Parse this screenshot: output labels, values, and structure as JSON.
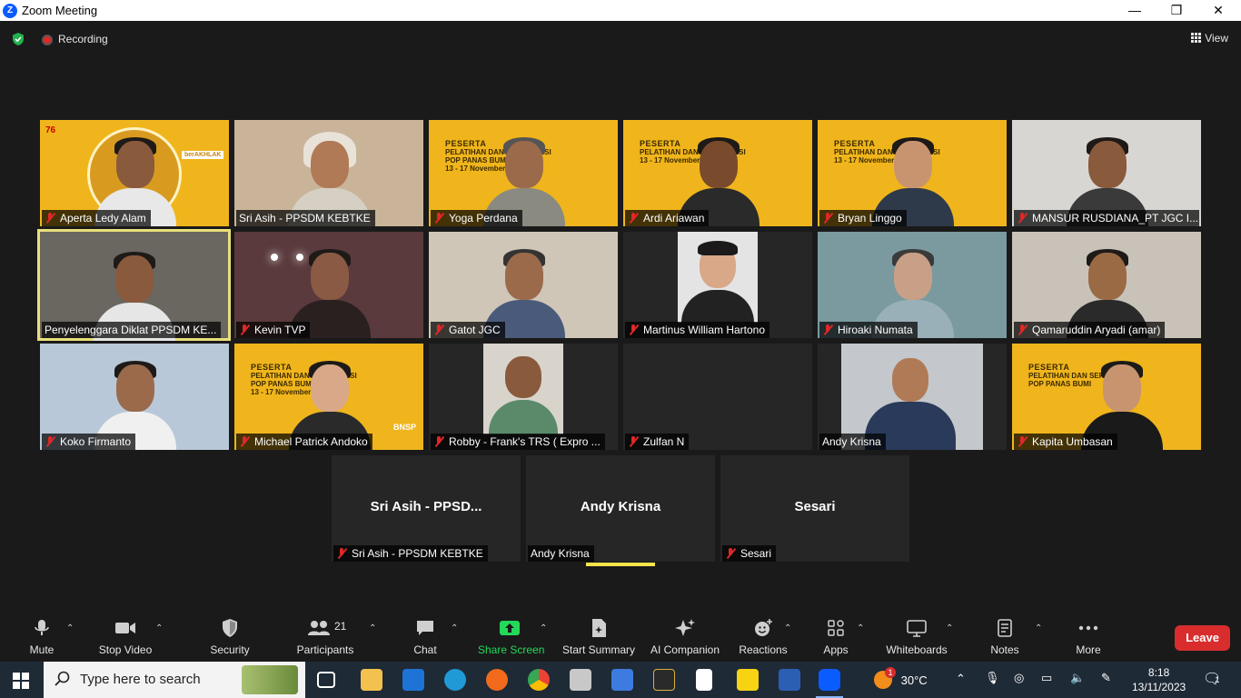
{
  "window": {
    "title": "Zoom Meeting",
    "minimize": "—",
    "maximize": "❐",
    "close": "✕"
  },
  "meeting_bar": {
    "recording_label": "Recording",
    "view_label": "View"
  },
  "participants": [
    {
      "name": "Aperta Ledy Alam",
      "muted": true
    },
    {
      "name": "Sri Asih - PPSDM KEBTKE",
      "muted": false
    },
    {
      "name": "Yoga Perdana",
      "muted": true
    },
    {
      "name": "Ardi Ariawan",
      "muted": true
    },
    {
      "name": "Bryan Linggo",
      "muted": true
    },
    {
      "name": "MANSUR RUSDIANA_PT JGC I...",
      "muted": true
    },
    {
      "name": "Penyelenggara Diklat PPSDM KE...",
      "muted": false
    },
    {
      "name": "Kevin TVP",
      "muted": true
    },
    {
      "name": "Gatot JGC",
      "muted": true
    },
    {
      "name": "Martinus William Hartono",
      "muted": true
    },
    {
      "name": "Hiroaki Numata",
      "muted": true
    },
    {
      "name": "Qamaruddin Aryadi (amar)",
      "muted": true
    },
    {
      "name": "Koko Firmanto",
      "muted": true
    },
    {
      "name": "Michael Patrick Andoko",
      "muted": true
    },
    {
      "name": "Robby - Frank's TRS ( Expro ...",
      "muted": true
    },
    {
      "name": "Zulfan N",
      "muted": true
    },
    {
      "name": "Andy Krisna",
      "muted": false
    },
    {
      "name": "Kapita Umbasan",
      "muted": true
    }
  ],
  "name_tiles": [
    {
      "display": "Sri Asih - PPSD...",
      "label": "Sri Asih - PPSDM KEBTKE",
      "muted": true
    },
    {
      "display": "Andy Krisna",
      "label": "Andy Krisna",
      "muted": false
    },
    {
      "display": "Sesari",
      "label": "Sesari",
      "muted": true
    }
  ],
  "banner": {
    "line1": "PESERTA",
    "line2": "PELATIHAN DAN SERTIFIKASI",
    "line3": "POP PANAS BUMI",
    "line4": "13 - 17 November 2023",
    "logo": "BNSP",
    "slogan": "berAKHLAK",
    "anniv": "76"
  },
  "toolbar": {
    "mute": "Mute",
    "stop_video": "Stop Video",
    "security": "Security",
    "participants": "Participants",
    "participants_count": "21",
    "chat": "Chat",
    "share_screen": "Share Screen",
    "start_summary": "Start Summary",
    "ai_companion": "AI Companion",
    "reactions": "Reactions",
    "apps": "Apps",
    "whiteboards": "Whiteboards",
    "notes": "Notes",
    "more": "More",
    "leave": "Leave"
  },
  "taskbar": {
    "search_placeholder": "Type here to search",
    "weather": "30°C",
    "time": "8:18",
    "date": "13/11/2023",
    "notification_count": "1",
    "weather_badge": "1"
  },
  "colors": {
    "accent": "#0b5cff",
    "share_green": "#23d959",
    "leave_red": "#d92d2d",
    "active_speaker": "#e8e07a",
    "banner_yellow": "#f0b51c"
  }
}
